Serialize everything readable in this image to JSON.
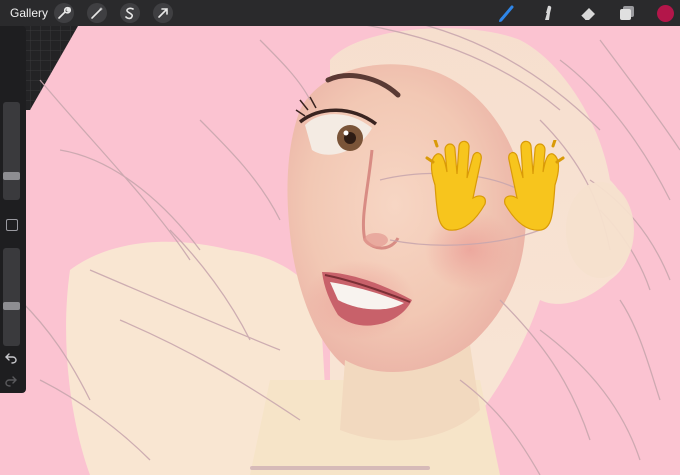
{
  "app": {
    "gallery_label": "Gallery",
    "toolbar_left": [
      "wrench-icon",
      "magic-wand-icon",
      "selection-icon",
      "transform-arrow-icon"
    ],
    "toolbar_right": [
      "brush-icon",
      "smudge-icon",
      "eraser-icon",
      "layers-icon"
    ],
    "current_color": "#b3164a",
    "brush_size_level": 0.78,
    "opacity_level": 0.6
  },
  "colors": {
    "background": "#fbc3d1",
    "toolbar": "#2a2a2c",
    "brush_active": "#2f86e8",
    "emoji": "#f7c51d"
  }
}
